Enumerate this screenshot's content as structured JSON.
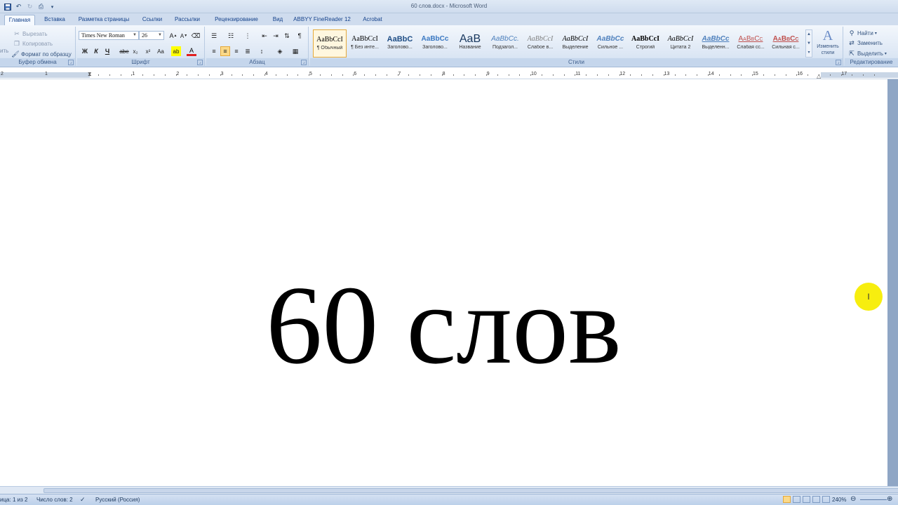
{
  "window": {
    "title": "60 слов.docx - Microsoft Word"
  },
  "tabs": [
    {
      "label": "Главная"
    },
    {
      "label": "Вставка"
    },
    {
      "label": "Разметка страницы"
    },
    {
      "label": "Ссылки"
    },
    {
      "label": "Рассылки"
    },
    {
      "label": "Рецензирование"
    },
    {
      "label": "Вид"
    },
    {
      "label": "ABBYY FineReader 12"
    },
    {
      "label": "Acrobat"
    }
  ],
  "clipboard": {
    "paste_partial": "ить",
    "cut": "Вырезать",
    "copy": "Копировать",
    "format_painter": "Формат по образцу",
    "label": "Буфер обмена"
  },
  "font": {
    "name": "Times New Roman",
    "size": "26",
    "label": "Шрифт",
    "bold": "Ж",
    "italic": "К",
    "underline": "Ч",
    "strike": "abe",
    "sub": "x₂",
    "sup": "x²",
    "case": "Aa",
    "color_letter": "A"
  },
  "paragraph": {
    "label": "Абзац"
  },
  "styles": {
    "label": "Стили",
    "items": [
      {
        "sample": "AaBbCcI",
        "name": "¶ Обычный"
      },
      {
        "sample": "AaBbCcI",
        "name": "¶ Без инте..."
      },
      {
        "sample": "AaBbC",
        "name": "Заголово..."
      },
      {
        "sample": "AaBbCc",
        "name": "Заголово..."
      },
      {
        "sample": "AaB",
        "name": "Название"
      },
      {
        "sample": "AaBbCc.",
        "name": "Подзагол..."
      },
      {
        "sample": "AaBbCcI",
        "name": "Слабое в..."
      },
      {
        "sample": "AaBbCcI",
        "name": "Выделение"
      },
      {
        "sample": "AaBbCc",
        "name": "Сильное ..."
      },
      {
        "sample": "AaBbCcI",
        "name": "Строгий"
      },
      {
        "sample": "AaBbCcI",
        "name": "Цитата 2"
      },
      {
        "sample": "AaBbCc",
        "name": "Выделенн..."
      },
      {
        "sample": "AaBbCc",
        "name": "Слабая сс..."
      },
      {
        "sample": "AaBbCc",
        "name": "Сильная с..."
      }
    ],
    "change_styles": "Изменить стили"
  },
  "editing": {
    "find": "Найти",
    "replace": "Заменить",
    "select": "Выделить",
    "label": "Редактирование"
  },
  "ruler": {
    "numbers": [
      "2",
      "1",
      "1",
      "2",
      "3",
      "4",
      "5",
      "6",
      "7",
      "8",
      "9",
      "10",
      "11",
      "12",
      "13",
      "14",
      "15",
      "16",
      "17"
    ]
  },
  "document": {
    "text": "60 слов"
  },
  "status": {
    "page": "ица: 1 из 2",
    "words": "Число слов: 2",
    "language": "Русский (Россия)",
    "zoom": "240%"
  }
}
